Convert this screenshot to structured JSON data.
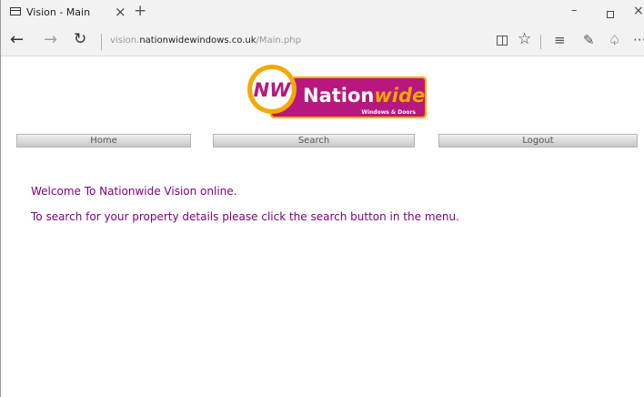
{
  "browser": {
    "tab": {
      "title": "Vision - Main",
      "close": "×"
    },
    "new_tab": "+",
    "window": {
      "minimize": "–",
      "close": "×"
    },
    "nav": {
      "back": "←",
      "forward": "→",
      "refresh": "↻"
    },
    "url": {
      "prefix": "vision.",
      "domain": "nationwidewindows.co.uk",
      "path": "/Main.php"
    },
    "toolbar": {
      "favorite": "☆",
      "hub": "≡",
      "note": "✎",
      "share": "♤",
      "more": "···"
    }
  },
  "logo": {
    "initials": "NW",
    "brand_main": "Nation",
    "brand_accent": "wide",
    "tagline": "Windows & Doors"
  },
  "colors": {
    "purple": "#b8177f",
    "gold": "#f5a800",
    "text": "#800080"
  },
  "menu": {
    "home": "Home",
    "search": "Search",
    "logout": "Logout"
  },
  "content": {
    "welcome": "Welcome To Nationwide Vision online.",
    "instructions": "To search for your property details please click the search button in the menu."
  }
}
